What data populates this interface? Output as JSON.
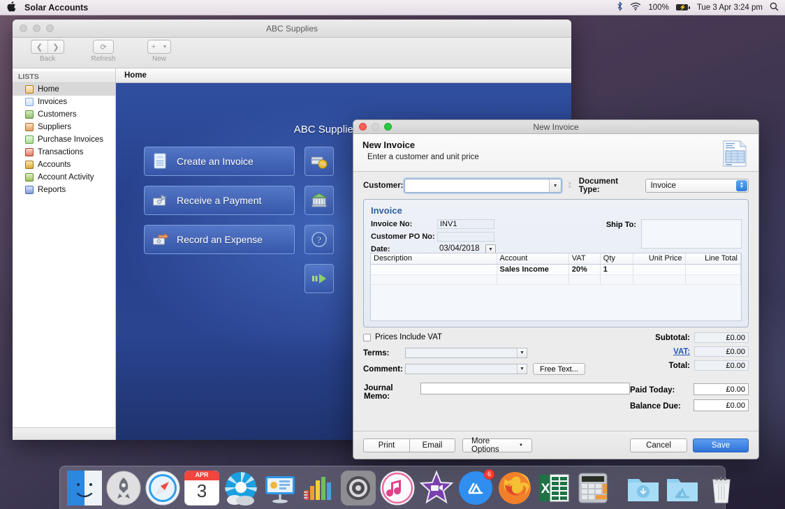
{
  "menubar": {
    "apple": "",
    "app_title": "Solar Accounts",
    "bluetooth_icon": "bluetooth-icon",
    "wifi_icon": "wifi-icon",
    "battery_percent": "100%",
    "datetime": "Tue 3 Apr  3:24 pm",
    "search_icon": "spotlight-search-icon"
  },
  "app_window": {
    "title": "ABC Supplies",
    "toolbar": {
      "back_label": "Back",
      "back_icon": "chevron-left-icon",
      "forward_icon": "chevron-right-icon",
      "refresh_label": "Refresh",
      "refresh_icon": "refresh-icon",
      "new_label": "New",
      "new_icon": "plus-icon",
      "new_chevron": "chevron-down-icon"
    },
    "sidebar": {
      "header": "LISTS",
      "items": [
        {
          "label": "Home",
          "icon": "home-icon",
          "active": true
        },
        {
          "label": "Invoices",
          "icon": "invoice-icon",
          "active": false
        },
        {
          "label": "Customers",
          "icon": "customers-icon",
          "active": false
        },
        {
          "label": "Suppliers",
          "icon": "suppliers-icon",
          "active": false
        },
        {
          "label": "Purchase Invoices",
          "icon": "purchase-invoice-icon",
          "active": false
        },
        {
          "label": "Transactions",
          "icon": "transactions-icon",
          "active": false
        },
        {
          "label": "Accounts",
          "icon": "accounts-icon",
          "active": false
        },
        {
          "label": "Account Activity",
          "icon": "account-activity-icon",
          "active": false
        },
        {
          "label": "Reports",
          "icon": "reports-icon",
          "active": false
        }
      ]
    },
    "tab_label": "Home",
    "home": {
      "brand": "ABC Supplies",
      "tiles": [
        {
          "label": "Create an Invoice",
          "icon": "invoice-document-icon"
        },
        {
          "label": "Receive a Payment",
          "icon": "receive-payment-icon"
        },
        {
          "label": "Record an Expense",
          "icon": "record-expense-icon"
        }
      ],
      "side_tiles": [
        {
          "icon": "discount-card-icon"
        },
        {
          "icon": "bank-icon"
        },
        {
          "icon": "help-icon"
        },
        {
          "icon": "next-arrow-icon"
        }
      ]
    }
  },
  "dialog": {
    "window_title": "New Invoice",
    "heading": "New Invoice",
    "subheading": "Enter a customer and unit price",
    "doc_icon": "invoice-document-icon",
    "customer_label": "Customer:",
    "customer_value": "",
    "customer_placeholder": "",
    "document_type_label": "Document Type:",
    "document_type_value": "Invoice",
    "invoice": {
      "section_title": "Invoice",
      "invoice_no_label": "Invoice No:",
      "invoice_no_value": "INV1",
      "customer_po_label": "Customer PO No:",
      "customer_po_value": "",
      "date_label": "Date:",
      "date_value": "03/04/2018",
      "ship_to_label": "Ship To:",
      "ship_to_value": ""
    },
    "line_table": {
      "columns": [
        "Description",
        "Account",
        "VAT",
        "Qty",
        "Unit Price",
        "Line Total"
      ],
      "rows": [
        {
          "description": "",
          "account": "Sales Income",
          "vat": "20%",
          "qty": "1",
          "unit_price": "",
          "line_total": ""
        }
      ]
    },
    "prices_include_vat_label": "Prices Include VAT",
    "prices_include_vat_checked": false,
    "terms_label": "Terms:",
    "terms_value": "",
    "comment_label": "Comment:",
    "comment_value": "",
    "free_text_label": "Free Text...",
    "totals": [
      {
        "label": "Subtotal:",
        "value": "£0.00",
        "link": false
      },
      {
        "label": "VAT:",
        "value": "£0.00",
        "link": true
      },
      {
        "label": "Total:",
        "value": "£0.00",
        "link": false
      }
    ],
    "journal_memo_label": "Journal Memo:",
    "journal_memo_value": "",
    "paid_today_label": "Paid Today:",
    "paid_today_value": "£0.00",
    "balance_due_label": "Balance Due:",
    "balance_due_value": "£0.00",
    "buttons": {
      "print": "Print",
      "email": "Email",
      "more_options": "More Options",
      "cancel": "Cancel",
      "save": "Save"
    },
    "colors": {
      "accent": "#2f72d8",
      "section_title": "#2f5f9e",
      "link": "#2255bb"
    }
  },
  "dock": {
    "items": [
      {
        "name": "finder-icon"
      },
      {
        "name": "launchpad-icon"
      },
      {
        "name": "safari-icon"
      },
      {
        "name": "calendar-icon",
        "month": "APR",
        "day": "3"
      },
      {
        "name": "photos-icon"
      },
      {
        "name": "keynote-icon"
      },
      {
        "name": "numbers-icon"
      },
      {
        "name": "system-preferences-icon"
      },
      {
        "name": "itunes-icon"
      },
      {
        "name": "imovie-icon"
      },
      {
        "name": "app-store-icon",
        "badge": "6"
      },
      {
        "name": "firefox-icon"
      },
      {
        "name": "excel-icon"
      },
      {
        "name": "calculator-icon"
      },
      {
        "name": "downloads-folder-icon"
      },
      {
        "name": "applications-folder-icon"
      },
      {
        "name": "trash-icon"
      }
    ]
  }
}
